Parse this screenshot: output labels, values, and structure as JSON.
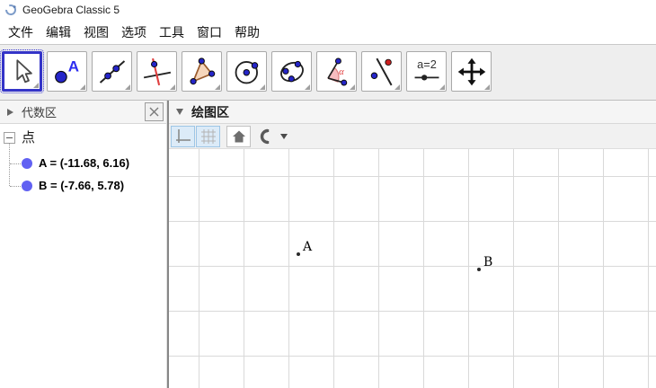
{
  "window": {
    "title": "GeoGebra Classic 5"
  },
  "menu_bar": {
    "items": [
      "文件",
      "编辑",
      "视图",
      "选项",
      "工具",
      "窗口",
      "帮助"
    ]
  },
  "toolbar": {
    "tools": [
      {
        "name": "move",
        "selected": true
      },
      {
        "name": "point",
        "selected": false
      },
      {
        "name": "line-through-two-points",
        "selected": false
      },
      {
        "name": "perpendicular-line",
        "selected": false
      },
      {
        "name": "polygon",
        "selected": false
      },
      {
        "name": "circle-with-center",
        "selected": false
      },
      {
        "name": "conic-through-points",
        "selected": false
      },
      {
        "name": "angle",
        "selected": false
      },
      {
        "name": "reflect-about-line",
        "selected": false
      },
      {
        "name": "slider",
        "selected": false,
        "label": "a=2"
      },
      {
        "name": "move-graphics-view",
        "selected": false
      }
    ]
  },
  "algebra_panel": {
    "title": "代数区",
    "group_label": "点",
    "items": [
      {
        "text": "A = (-11.68, 6.16)"
      },
      {
        "text": "B = (-7.66, 5.78)"
      }
    ],
    "point_color": "#6161f2"
  },
  "graphics_panel": {
    "title": "绘图区",
    "points": [
      {
        "label": "A",
        "x": -11.68,
        "y": 6.16
      },
      {
        "label": "B",
        "x": -7.66,
        "y": 5.78
      }
    ]
  },
  "colors": {
    "selected_tool_border": "#3434c8",
    "grid_line": "#d9d9d9",
    "point_bullet": "#6161f2",
    "toolbar_bg": "#eeeeee"
  }
}
